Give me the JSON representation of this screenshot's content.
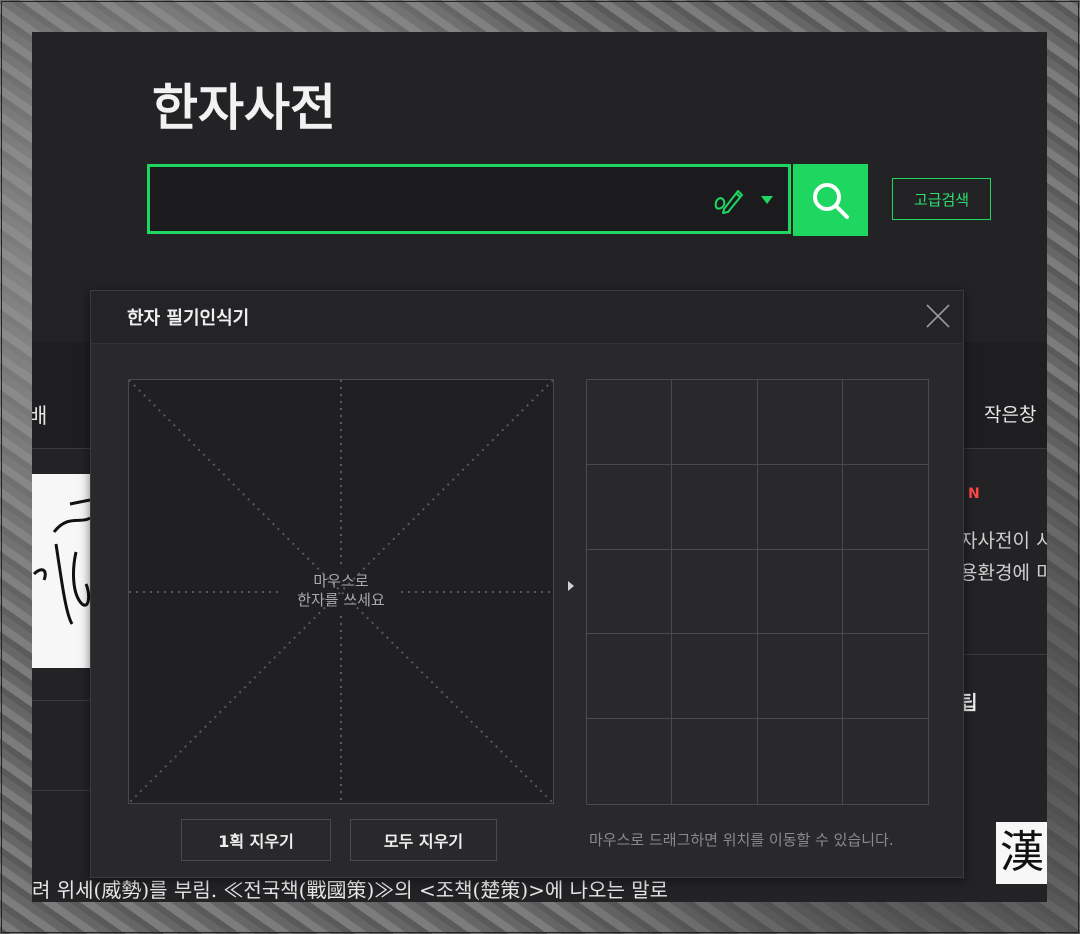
{
  "header": {
    "title": "한자사전",
    "search_placeholder": "",
    "advanced_search_label": "고급검색"
  },
  "background_page": {
    "left_tab_fragment": "배",
    "right_tab_label": "작은창",
    "new_badge": "N",
    "news_lines": [
      "자사전이 시",
      "용환경에 미"
    ],
    "tip_fragment": "팁",
    "hanja_thumbnail": "漢",
    "example_sentence": "려 위세(威勢)를 부림. ≪전국책(戰國策)≫의 <조책(楚策)>에 나오는 말로"
  },
  "handwriting_modal": {
    "title": "한자 필기인식기",
    "hint_line1": "마우스로",
    "hint_line2": "한자를 쓰세요",
    "erase_stroke_label": "1획 지우기",
    "erase_all_label": "모두 지우기",
    "drag_hint": "마우스로 드래그하면 위치를 이동할 수 있습니다."
  },
  "colors": {
    "accent": "#1ed760",
    "page_bg": "#232326",
    "modal_bg": "#29292c",
    "new_badge": "#ff4747"
  },
  "icons": {
    "pen": "pen-icon",
    "dropdown": "chevron-down-icon",
    "search": "search-icon",
    "close": "close-icon",
    "arrow": "arrow-right-icon"
  }
}
